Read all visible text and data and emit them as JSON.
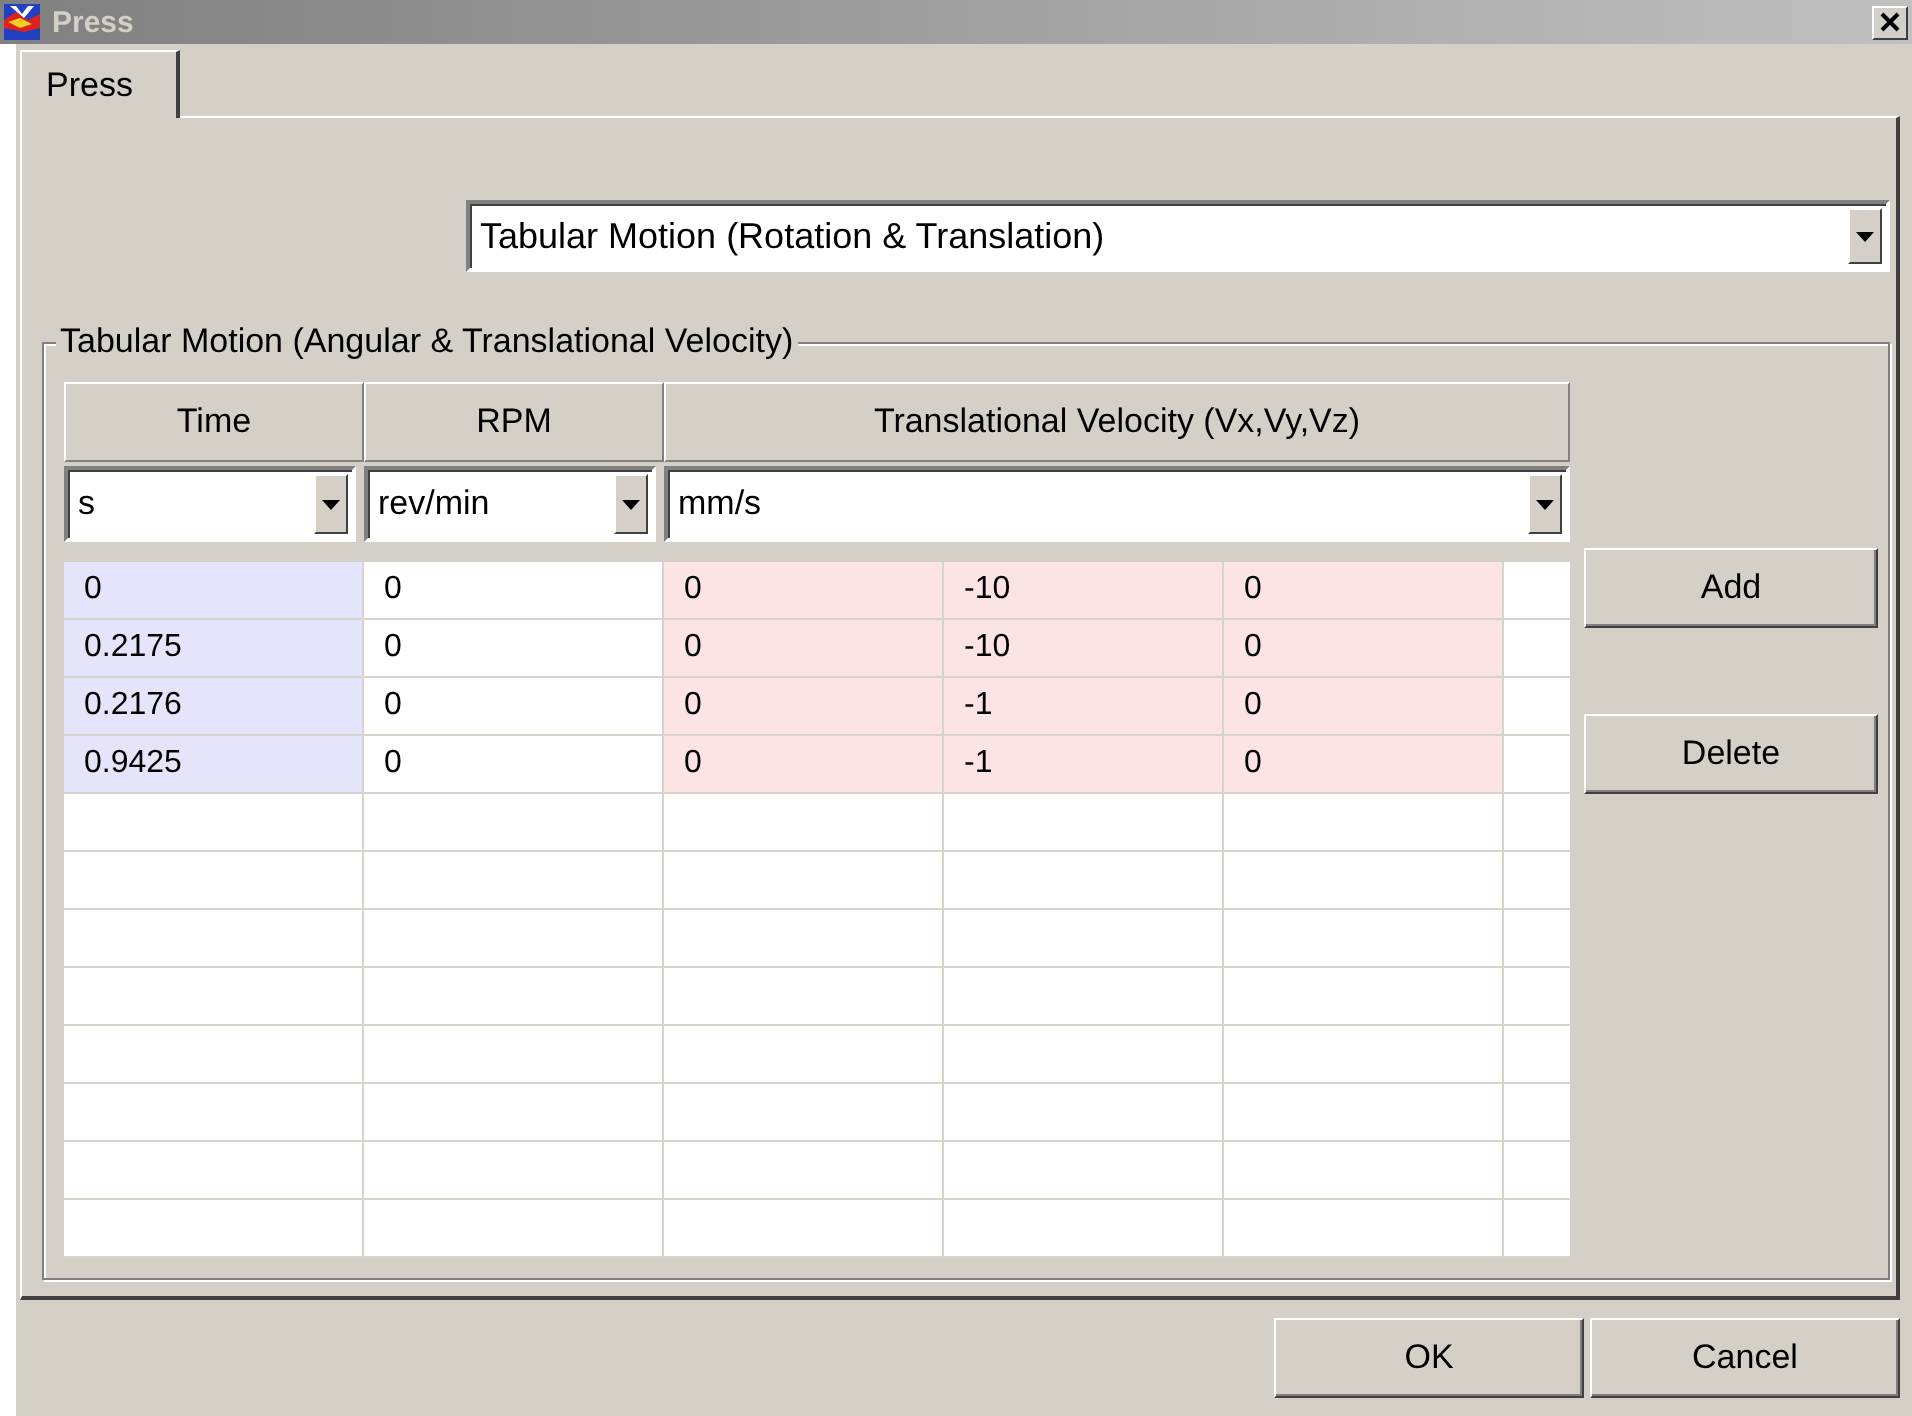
{
  "window": {
    "title": "Press"
  },
  "tabs": [
    {
      "label": "Press",
      "selected": true
    }
  ],
  "motion_type": {
    "value": "Tabular Motion (Rotation & Translation)"
  },
  "group": {
    "title": "Tabular Motion (Angular & Translational Velocity)"
  },
  "table": {
    "columns": [
      "Time",
      "RPM"
    ],
    "group_header": "Translational Velocity (Vx,Vy,Vz)",
    "units": [
      "s",
      "rev/min",
      "mm/s"
    ],
    "rows": [
      [
        "0",
        "0",
        "0",
        "-10",
        "0"
      ],
      [
        "0.2175",
        "0",
        "0",
        "-10",
        "0"
      ],
      [
        "0.2176",
        "0",
        "0",
        "-1",
        "0"
      ],
      [
        "0.9425",
        "0",
        "0",
        "-1",
        "0"
      ]
    ]
  },
  "side_buttons": [
    "Add",
    "Delete"
  ],
  "buttons": [
    "OK",
    "Cancel"
  ]
}
